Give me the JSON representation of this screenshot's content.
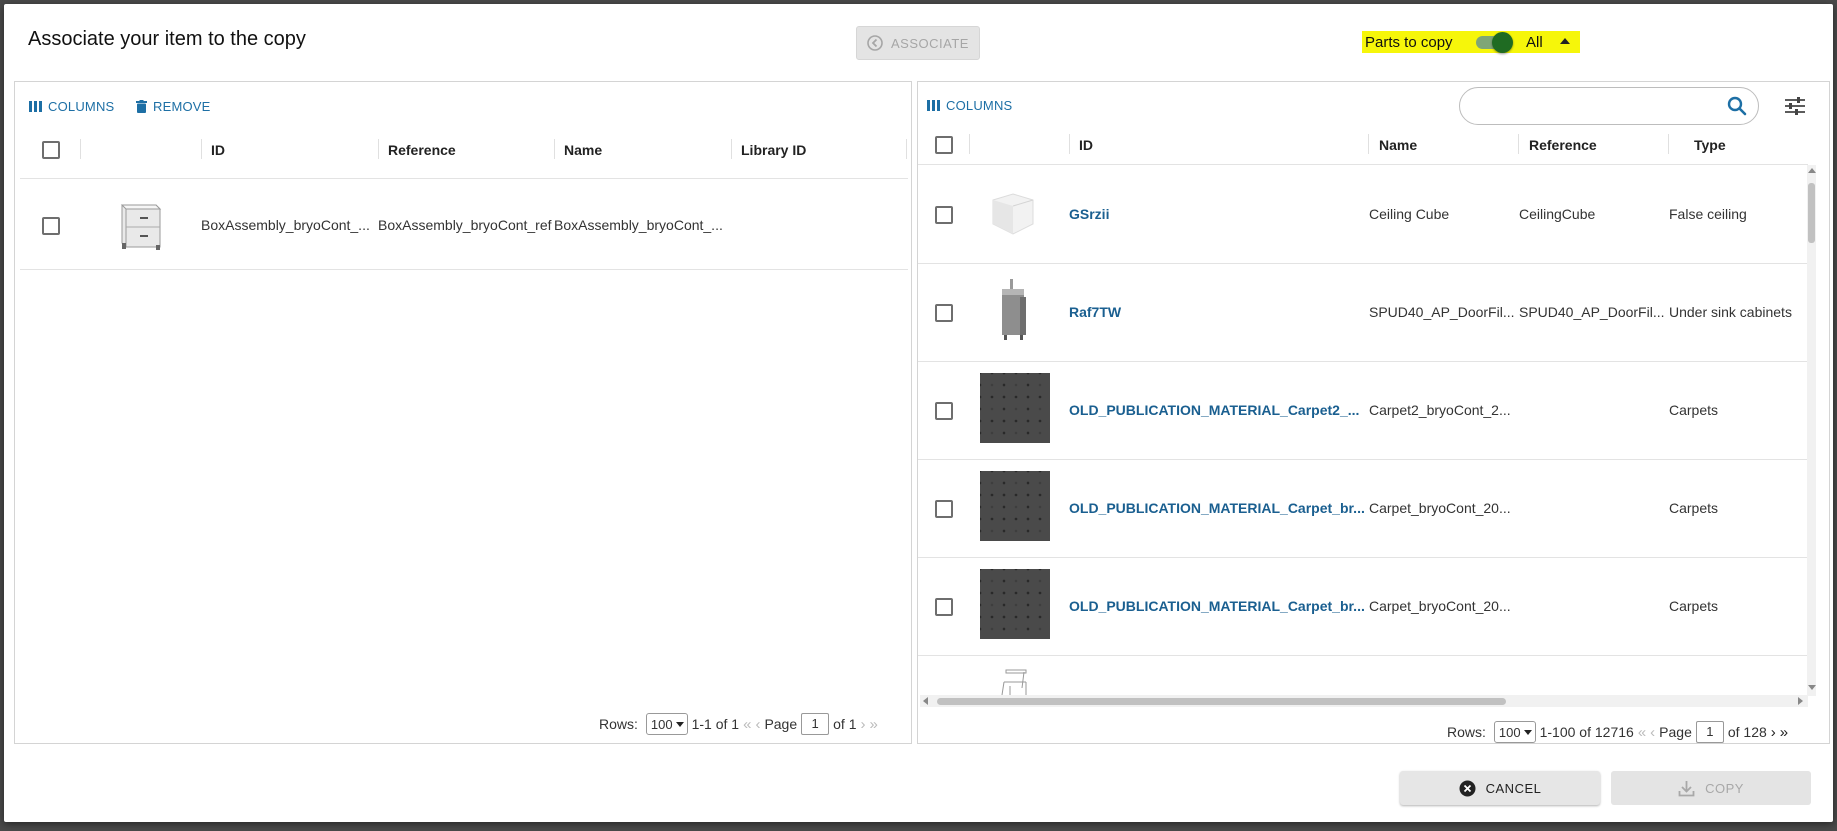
{
  "dialog": {
    "title": "Associate your item to the copy",
    "associate_label": "ASSOCIATE",
    "parts_to_copy": {
      "label": "Parts to copy",
      "toggle_on": true,
      "value": "All"
    }
  },
  "left_panel": {
    "toolbar": {
      "columns_label": "COLUMNS",
      "remove_label": "REMOVE"
    },
    "headers": [
      "ID",
      "Reference",
      "Name",
      "Library ID"
    ],
    "rows": [
      {
        "id": "BoxAssembly_bryoCont_...",
        "reference": "BoxAssembly_bryoCont_ref",
        "name": "BoxAssembly_bryoCont_...",
        "library_id": ""
      }
    ],
    "footer": {
      "rows_label": "Rows:",
      "rows_per_page": "100",
      "range": "1-1 of 1",
      "page_label": "Page",
      "page": "1",
      "of_pages": "of 1"
    }
  },
  "right_panel": {
    "toolbar": {
      "columns_label": "COLUMNS",
      "search_placeholder": ""
    },
    "headers": [
      "ID",
      "Name",
      "Reference",
      "Type"
    ],
    "rows": [
      {
        "id": "GSrzii",
        "name": "Ceiling Cube",
        "reference": "CeilingCube",
        "type": "False ceiling",
        "thumb": "ceiling-cube"
      },
      {
        "id": "Raf7TW",
        "name": "SPUD40_AP_DoorFil...",
        "reference": "SPUD40_AP_DoorFil...",
        "type": "Under sink cabinets",
        "thumb": "sink-cabinet"
      },
      {
        "id": "OLD_PUBLICATION_MATERIAL_Carpet2_...",
        "name": "Carpet2_bryoCont_2...",
        "reference": "",
        "type": "Carpets",
        "thumb": "carpet"
      },
      {
        "id": "OLD_PUBLICATION_MATERIAL_Carpet_br...",
        "name": "Carpet_bryoCont_20...",
        "reference": "",
        "type": "Carpets",
        "thumb": "carpet"
      },
      {
        "id": "OLD_PUBLICATION_MATERIAL_Carpet_br...",
        "name": "Carpet_bryoCont_20...",
        "reference": "",
        "type": "Carpets",
        "thumb": "carpet"
      }
    ],
    "footer": {
      "rows_label": "Rows:",
      "rows_per_page": "100",
      "range": "1-100 of 12716",
      "page_label": "Page",
      "page": "1",
      "of_pages": "of 128"
    }
  },
  "actions": {
    "cancel_label": "CANCEL",
    "copy_label": "COPY"
  }
}
